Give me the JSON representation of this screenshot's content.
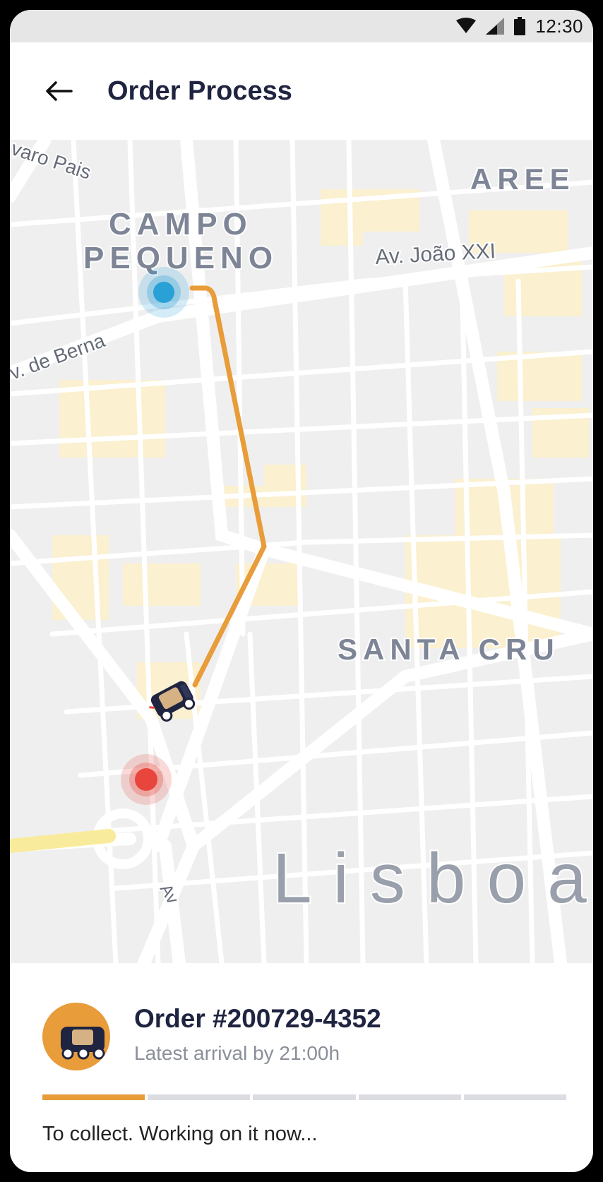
{
  "status_bar": {
    "time": "12:30",
    "icons": [
      "wifi-icon",
      "cellular-signal-icon",
      "battery-icon"
    ]
  },
  "header": {
    "title": "Order Process",
    "back_icon": "arrow-left-icon"
  },
  "map": {
    "labels": {
      "campo": "CAMPO",
      "pequeno": "PEQUENO",
      "aree": "AREE",
      "joao": "Av. João XXI",
      "berna": "v. de Berna",
      "pais": "varo Pais",
      "santa_cruz": "SANTA CRU",
      "lisboa": "Lisboa",
      "av": "Av"
    },
    "route_color": "#e89c3a",
    "origin_color": "#29a0d6",
    "destination_color": "#e8453c"
  },
  "order": {
    "title": "Order #200729-4352",
    "subtitle": "Latest arrival by 21:00h",
    "progress_steps": 5,
    "progress_completed": 1,
    "status_message": "To collect. Working on it now..."
  },
  "colors": {
    "accent": "#e89c3a",
    "title": "#1f2440",
    "muted": "#8a8f99"
  }
}
